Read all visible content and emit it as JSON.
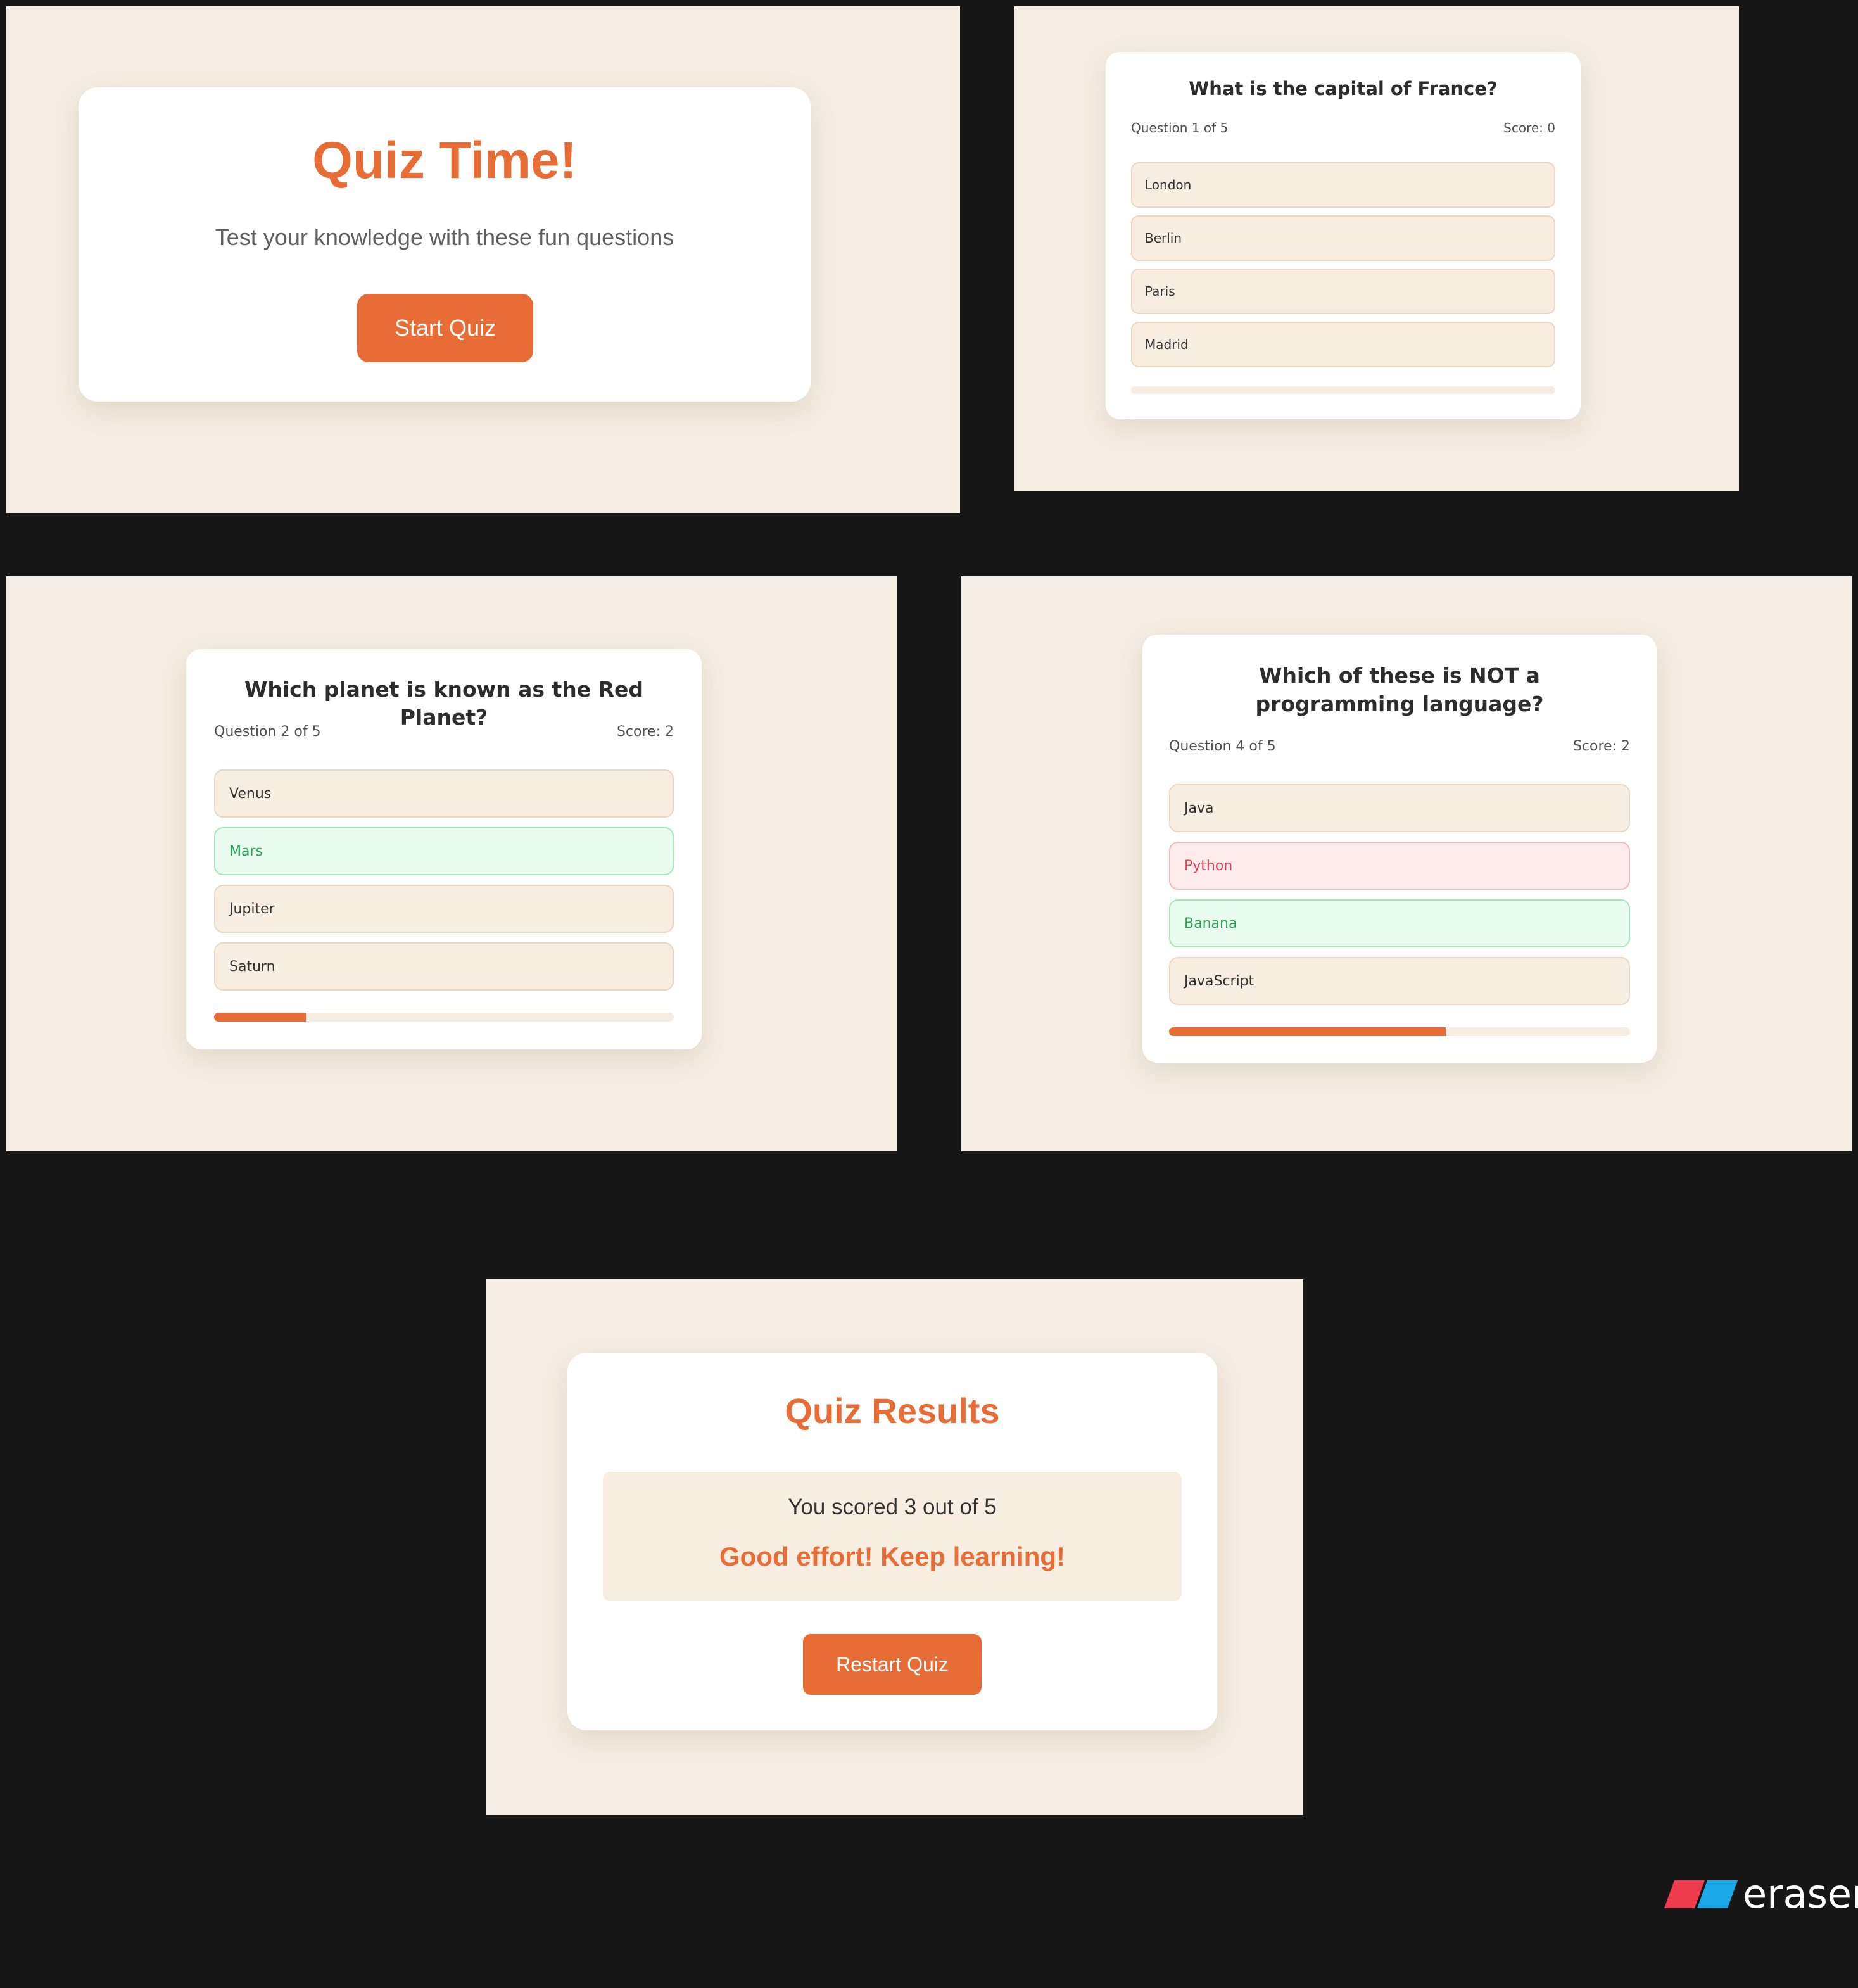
{
  "colors": {
    "accent": "#e76c35",
    "panel_bg": "#f5ede3",
    "correct": "#27a351",
    "wrong": "#d8455a",
    "logo_red": "#ef3b4e",
    "logo_blue": "#1aa8e8"
  },
  "start_screen": {
    "title": "Quiz Time!",
    "subtitle": "Test your knowledge with these fun questions",
    "start_label": "Start Quiz"
  },
  "question1": {
    "question": "What is the capital of France?",
    "progress_text": "Question 1 of 5",
    "score_text": "Score: 0",
    "options": [
      "London",
      "Berlin",
      "Paris",
      "Madrid"
    ],
    "progress_fraction": 0
  },
  "question2": {
    "question": "Which planet is known as the Red Planet?",
    "progress_text": "Question 2 of 5",
    "score_text": "Score: 2",
    "options": [
      "Venus",
      "Mars",
      "Jupiter",
      "Saturn"
    ],
    "correct_option": "Mars",
    "progress_fraction": 0.2
  },
  "question4": {
    "question": "Which of these is NOT a programming language?",
    "progress_text": "Question 4 of 5",
    "score_text": "Score: 2",
    "options": [
      "Java",
      "Python",
      "Banana",
      "JavaScript"
    ],
    "wrong_option": "Python",
    "correct_option": "Banana",
    "progress_fraction": 0.6
  },
  "results": {
    "title": "Quiz Results",
    "score_text": "You scored 3 out of 5",
    "message": "Good effort! Keep learning!",
    "restart_label": "Restart Quiz"
  },
  "branding": {
    "logo_icon": "eraser-logo-icon",
    "logo_text": "eraser"
  }
}
